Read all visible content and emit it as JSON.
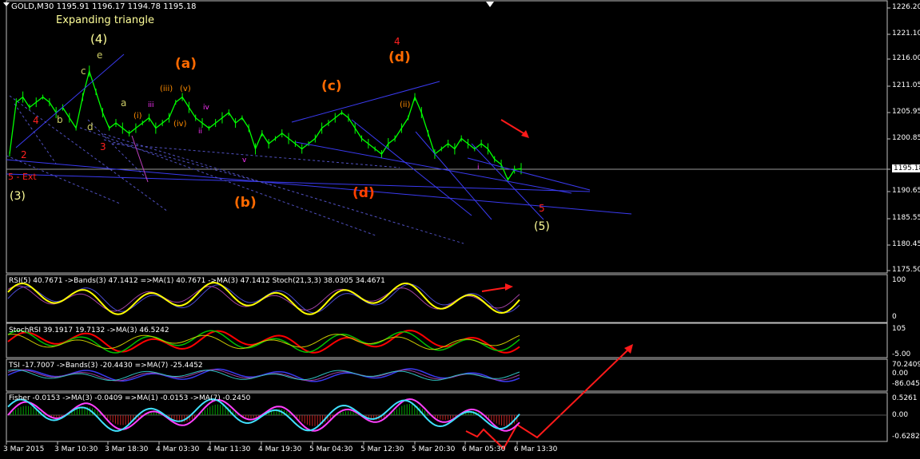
{
  "header": {
    "symbol_line": "GOLD,M30  1195.91 1196.17 1194.78 1195.18",
    "subtitle": "Expanding triangle"
  },
  "price_axis": {
    "labels": [
      "1226.20",
      "1221.10",
      "1216.00",
      "1211.05",
      "1205.95",
      "1200.85",
      "1195.18",
      "1190.65",
      "1185.55",
      "1180.45",
      "1175.50"
    ],
    "current_label": "1195.18"
  },
  "time_axis": {
    "labels": [
      "3 Mar 2015",
      "3 Mar 10:30",
      "3 Mar 18:30",
      "4 Mar 03:30",
      "4 Mar 11:30",
      "4 Mar 19:30",
      "5 Mar 04:30",
      "5 Mar 12:30",
      "5 Mar 20:30",
      "6 Mar 05:30",
      "6 Mar 13:30"
    ]
  },
  "indicators": {
    "rsi_label": "RSI(5) 40.7671  ->Bands(3) 47.1412  =>MA(1) 40.7671  ->MA(3) 47.1412  Stoch(21,3,3) 38.0305 34.4671",
    "rsi_axis": [
      "100",
      "0"
    ],
    "stochrsi_label": "StochRSI 39.1917 19.7132  ->MA(3) 46.5242",
    "stochrsi_axis": [
      "105",
      "-5.00"
    ],
    "tsi_label": "TSI -17.7007  ->Bands(3) -20.4430  =>MA(7) -25.4452",
    "tsi_axis": [
      "70.2409",
      "0.00",
      "-86.0452"
    ],
    "fisher_label": "Fisher -0.0153  ->MA(3) -0.0409  =>MA(1) -0.0153  ->MA(7) -0.2450",
    "fisher_axis": [
      "0.5261",
      "0.00",
      "-0.6282"
    ]
  },
  "wave_labels": [
    {
      "text": "(4)",
      "color": "#ffff99"
    },
    {
      "text": "(a)",
      "color": "#ff6a00"
    },
    {
      "text": "(b)",
      "color": "#ff6a00"
    },
    {
      "text": "(c)",
      "color": "#ff6a00"
    },
    {
      "text": "(d)",
      "color": "#ff6a00"
    },
    {
      "text": "(d)",
      "color": "#ff4000"
    },
    {
      "text": "4",
      "color": "#ff2020"
    },
    {
      "text": "(3)",
      "color": "#ffff99"
    },
    {
      "text": "(5)",
      "color": "#ffff99"
    },
    {
      "text": "5 - Ext",
      "color": "#ff2020"
    },
    {
      "text": "e",
      "color": "#cccc66"
    },
    {
      "text": "a",
      "color": "#cccc66"
    },
    {
      "text": "b",
      "color": "#cccc66"
    },
    {
      "text": "c",
      "color": "#cccc66"
    },
    {
      "text": "d",
      "color": "#cccc66"
    },
    {
      "text": "(iii)",
      "color": "#ff8c00"
    },
    {
      "text": "(iv)",
      "color": "#ff8c00"
    },
    {
      "text": "(v)",
      "color": "#ff8c00"
    },
    {
      "text": "(i)",
      "color": "#ff8c00"
    },
    {
      "text": "(ii)",
      "color": "#ff8c00"
    },
    {
      "text": "iii",
      "color": "#ff33ff"
    },
    {
      "text": "iv",
      "color": "#ff33ff"
    },
    {
      "text": "ii",
      "color": "#ff33ff"
    },
    {
      "text": "v",
      "color": "#ff33ff"
    },
    {
      "text": "i",
      "color": "#ff33ff"
    },
    {
      "text": "5",
      "color": "#ff2020"
    },
    {
      "text": "3",
      "color": "#ff2020"
    },
    {
      "text": "2",
      "color": "#ff2020"
    },
    {
      "text": "4",
      "color": "#ff2020"
    }
  ],
  "chart_data": {
    "type": "line",
    "title": "GOLD,M30  1195.91 1196.17 1194.78 1195.18",
    "ylim": [
      1174,
      1227
    ],
    "grid": false,
    "series": [
      {
        "name": "GOLD,M30",
        "color": "#00ff00",
        "values": [
          1198,
          1208,
          1209,
          1207,
          1208,
          1209,
          1208,
          1206,
          1207,
          1205,
          1203,
          1209,
          1214,
          1210,
          1206,
          1203,
          1204,
          1203,
          1202,
          1203,
          1204,
          1205,
          1203,
          1204,
          1205,
          1208,
          1209,
          1207,
          1205,
          1204,
          1203,
          1204,
          1205,
          1206,
          1204,
          1205,
          1203,
          1199,
          1202,
          1200,
          1201,
          1202,
          1201,
          1200,
          1199,
          1200,
          1201,
          1203,
          1204,
          1205,
          1206,
          1205,
          1203,
          1201,
          1200,
          1199,
          1198,
          1200,
          1201,
          1203,
          1205,
          1209,
          1206,
          1202,
          1198,
          1199,
          1200,
          1199,
          1201,
          1200,
          1199,
          1200,
          1199,
          1197,
          1196,
          1193,
          1195,
          1195.18
        ]
      }
    ],
    "indicator_panels": [
      "RSI(5)",
      "StochRSI",
      "TSI",
      "Fisher"
    ]
  }
}
